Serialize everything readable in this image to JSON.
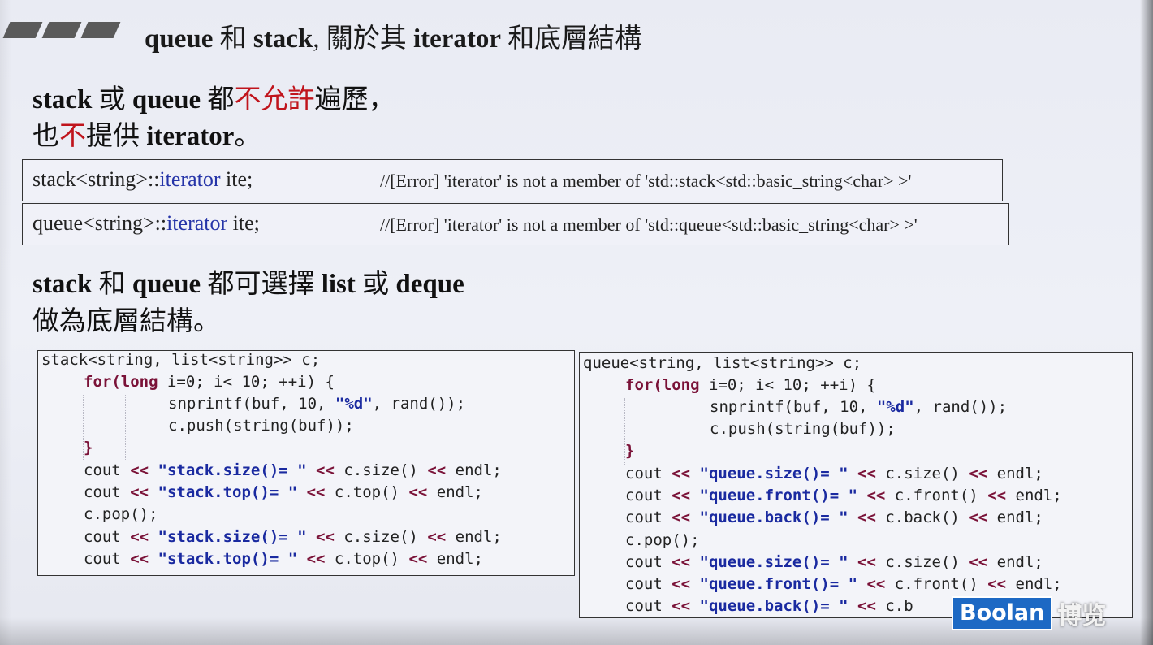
{
  "title": {
    "a": "queue",
    "b": " 和 ",
    "c": "stack",
    "d": ", 關於其 ",
    "e": "iterator",
    "f": " 和底層結構"
  },
  "section1": {
    "line1": {
      "a": "stack",
      "b": " 或 ",
      "c": "queue",
      "d": " 都",
      "e": "不允許",
      "f": "遍歷，"
    },
    "line2": {
      "a": "也",
      "b": "不",
      "c": "提供 ",
      "d": "iterator",
      "e": "。"
    }
  },
  "errors": [
    {
      "pre": "stack<string>::",
      "kw": "iterator",
      "post": " ite;",
      "comment": "//[Error] 'iterator' is not a member of 'std::stack<std::basic_string<char> >'"
    },
    {
      "pre": "queue<string>::",
      "kw": "iterator",
      "post": " ite;",
      "comment": "//[Error] 'iterator' is not a member of 'std::queue<std::basic_string<char> >'"
    }
  ],
  "section2": {
    "line1": {
      "a": "stack",
      "b": " 和 ",
      "c": "queue",
      "d": " 都可選擇 ",
      "e": "list",
      "f": " 或 ",
      "g": "deque"
    },
    "line2": "做為底層結構。"
  },
  "stack_code": {
    "l1": "stack<string, list<string>> c;",
    "for_kw": "for",
    "for_open": "(",
    "long_kw": "long",
    "for_rest": " i=0; i< 10; ++i) {",
    "snp": "snprintf(buf, 10, ",
    "fmt": "\"%d\"",
    "snp_rest": ", rand());",
    "push": "c.push(string(buf));",
    "close": "}",
    "cout": "cout ",
    "op": "<<",
    "size_str": "\"stack.size()= \"",
    "top_str": "\"stack.top()= \"",
    "size_call": " c.size() ",
    "top_call": " c.top() ",
    "endl": " endl;",
    "pop": "c.pop();"
  },
  "queue_code": {
    "l1": "queue<string, list<string>> c;",
    "for_kw": "for",
    "for_open": "(",
    "long_kw": "long",
    "for_rest": " i=0; i< 10; ++i) {",
    "snp": "snprintf(buf, 10, ",
    "fmt": "\"%d\"",
    "snp_rest": ", rand());",
    "push": "c.push(string(buf));",
    "close": "}",
    "cout": "cout ",
    "op": "<<",
    "size_str": "\"queue.size()= \"",
    "front_str": "\"queue.front()= \"",
    "back_str": "\"queue.back()= \"",
    "size_call": " c.size() ",
    "front_call": " c.front() ",
    "back_call": " c.back() ",
    "endl": " endl;",
    "pop": "c.pop();",
    "last_partial": " c.b"
  },
  "logo": {
    "brand": "Boolan",
    "cn": "博览"
  }
}
